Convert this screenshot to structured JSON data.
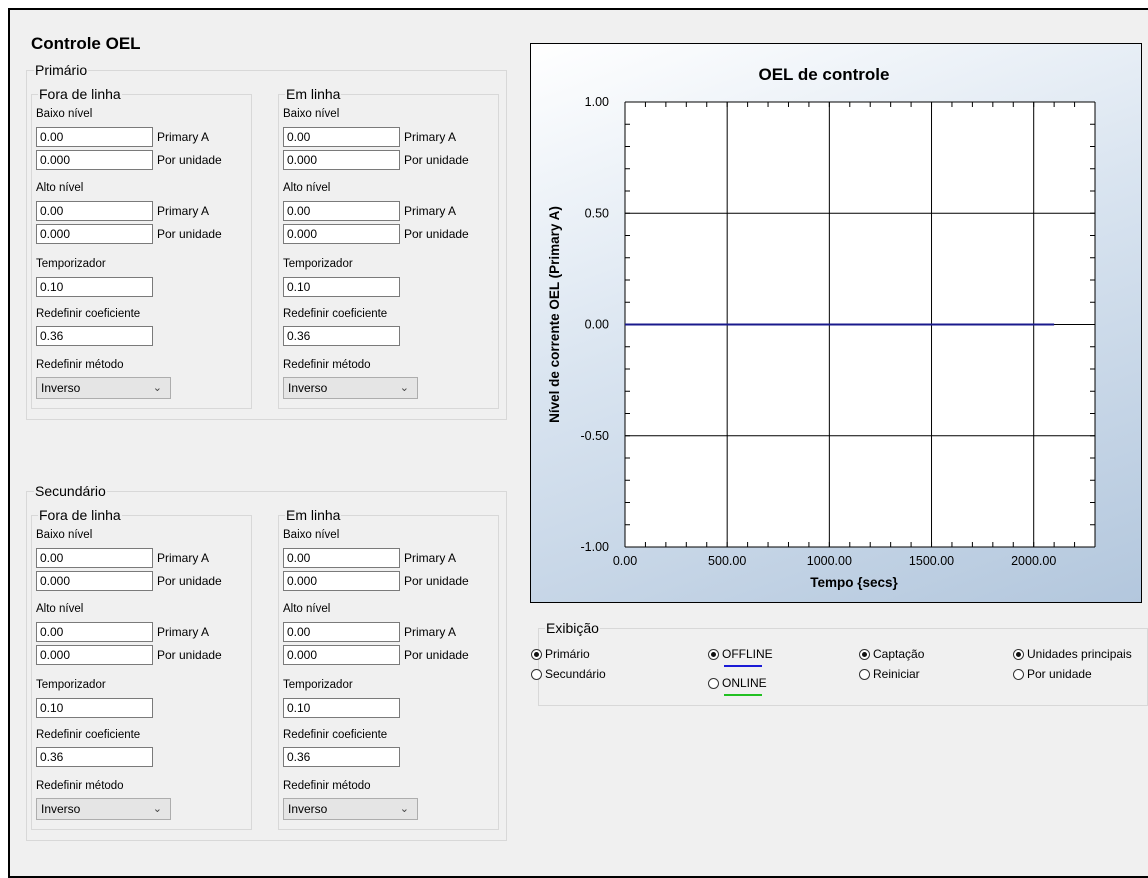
{
  "page_title": "Controle OEL",
  "groups": {
    "primario": {
      "label": "Primário",
      "offline": {
        "label": "Fora de linha",
        "baixo_label": "Baixo nível",
        "baixo_a": "0.00",
        "baixo_a_unit": "Primary A",
        "baixo_pu": "0.000",
        "baixo_pu_unit": "Por unidade",
        "alto_label": "Alto nível",
        "alto_a": "0.00",
        "alto_a_unit": "Primary A",
        "alto_pu": "0.000",
        "alto_pu_unit": "Por unidade",
        "timer_label": "Temporizador",
        "timer": "0.10",
        "coef_label": "Redefinir coeficiente",
        "coef": "0.36",
        "method_label": "Redefinir método",
        "method": "Inverso"
      },
      "online": {
        "label": "Em linha",
        "baixo_label": "Baixo nível",
        "baixo_a": "0.00",
        "baixo_a_unit": "Primary A",
        "baixo_pu": "0.000",
        "baixo_pu_unit": "Por unidade",
        "alto_label": "Alto nível",
        "alto_a": "0.00",
        "alto_a_unit": "Primary A",
        "alto_pu": "0.000",
        "alto_pu_unit": "Por unidade",
        "timer_label": "Temporizador",
        "timer": "0.10",
        "coef_label": "Redefinir coeficiente",
        "coef": "0.36",
        "method_label": "Redefinir método",
        "method": "Inverso"
      }
    },
    "secundario": {
      "label": "Secundário",
      "offline": {
        "label": "Fora de linha",
        "baixo_label": "Baixo nível",
        "baixo_a": "0.00",
        "baixo_a_unit": "Primary A",
        "baixo_pu": "0.000",
        "baixo_pu_unit": "Por unidade",
        "alto_label": "Alto nível",
        "alto_a": "0.00",
        "alto_a_unit": "Primary A",
        "alto_pu": "0.000",
        "alto_pu_unit": "Por unidade",
        "timer_label": "Temporizador",
        "timer": "0.10",
        "coef_label": "Redefinir coeficiente",
        "coef": "0.36",
        "method_label": "Redefinir método",
        "method": "Inverso"
      },
      "online": {
        "label": "Em linha",
        "baixo_label": "Baixo nível",
        "baixo_a": "0.00",
        "baixo_a_unit": "Primary A",
        "baixo_pu": "0.000",
        "baixo_pu_unit": "Por unidade",
        "alto_label": "Alto nível",
        "alto_a": "0.00",
        "alto_a_unit": "Primary A",
        "alto_pu": "0.000",
        "alto_pu_unit": "Por unidade",
        "timer_label": "Temporizador",
        "timer": "0.10",
        "coef_label": "Redefinir coeficiente",
        "coef": "0.36",
        "method_label": "Redefinir método",
        "method": "Inverso"
      }
    }
  },
  "display": {
    "label": "Exibição",
    "primario": "Primário",
    "secundario": "Secundário",
    "offline": "OFFLINE",
    "online": "ONLINE",
    "captacao": "Captação",
    "reiniciar": "Reiniciar",
    "unidades_principais": "Unidades principais",
    "por_unidade": "Por unidade",
    "selected": {
      "system": "primario",
      "mode": "offline",
      "action": "captacao",
      "units": "unidades_principais"
    },
    "offline_color": "#1a1ad6",
    "online_color": "#22c022"
  },
  "chart_data": {
    "type": "line",
    "title": "OEL de controle",
    "xlabel": "Tempo {secs}",
    "ylabel": "Nível de corrente OEL (Primary A)",
    "xlim": [
      0,
      2300
    ],
    "ylim": [
      -1.0,
      1.0
    ],
    "xticks": [
      "0.00",
      "500.00",
      "1000.00",
      "1500.00",
      "2000.00"
    ],
    "yticks": [
      "1.00",
      "0.50",
      "0.00",
      "-0.50",
      "-1.00"
    ],
    "grid": true,
    "series": [
      {
        "x": [
          0,
          2100
        ],
        "y": [
          0.0,
          0.0
        ],
        "color": "#1a1a8c"
      }
    ]
  }
}
